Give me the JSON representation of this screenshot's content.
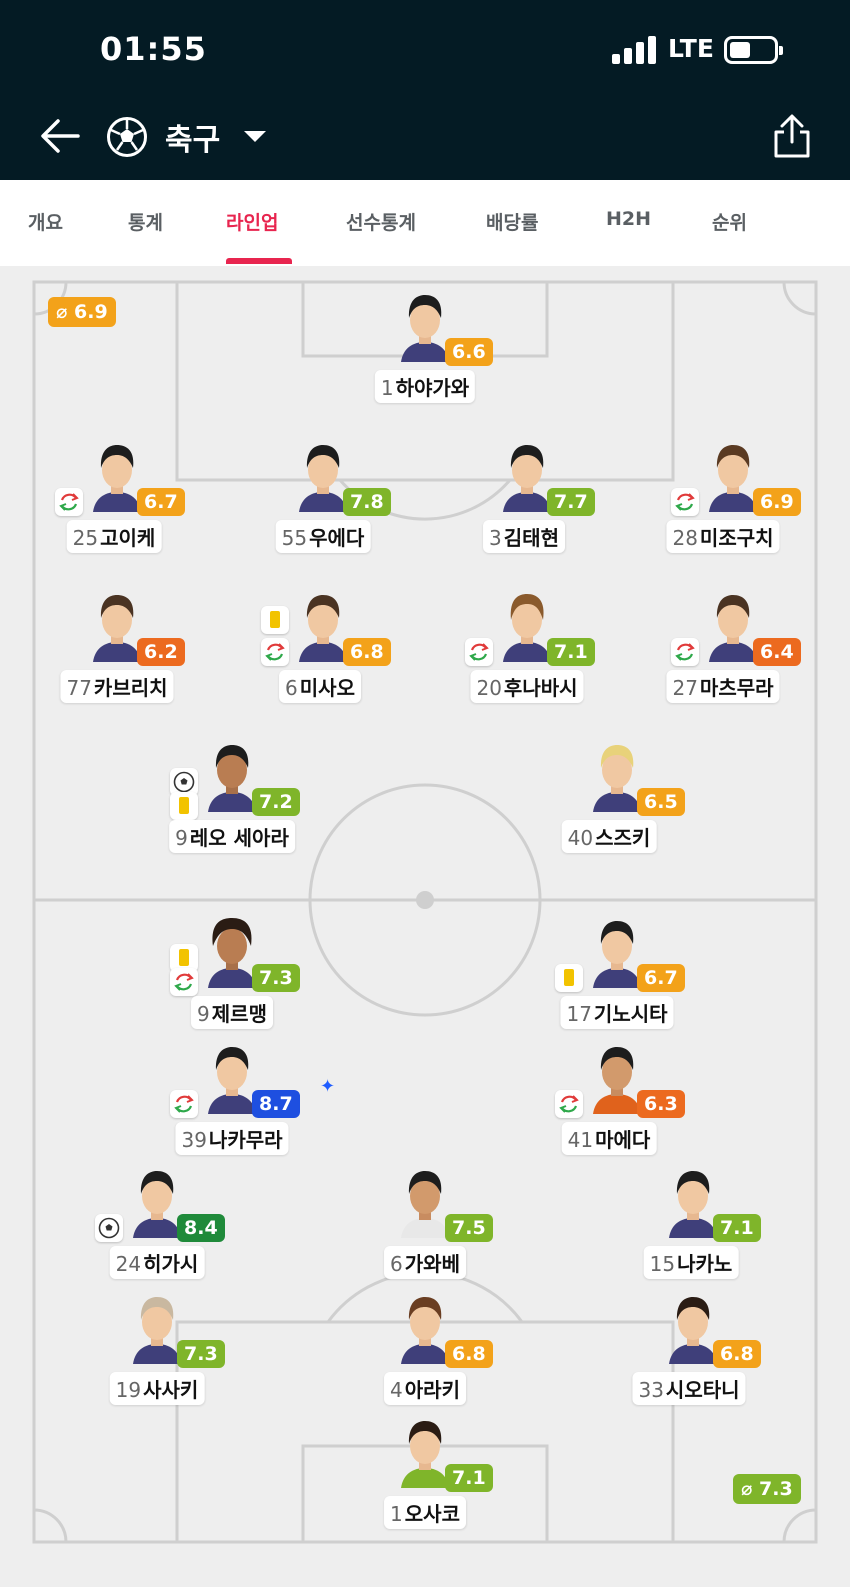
{
  "status_bar": {
    "time": "01:55",
    "network": "LTE"
  },
  "header": {
    "sport": "축구",
    "back_icon": "arrow-left-icon",
    "ball_icon": "soccer-ball-icon",
    "share_icon": "share-icon"
  },
  "tabs": [
    {
      "label": "개요"
    },
    {
      "label": "통계"
    },
    {
      "label": "라인업",
      "active": true
    },
    {
      "label": "선수통계"
    },
    {
      "label": "배당률"
    },
    {
      "label": "H2H"
    },
    {
      "label": "순위"
    }
  ],
  "colors": {
    "orange": "#f3a21a",
    "lightgreen": "#7fb52a",
    "green": "#1f8a3a",
    "darkorange": "#ec6a1f",
    "blue": "#1e4fe0",
    "yellowcard": "#f2c300",
    "accent": "#e8254f"
  },
  "lineup": {
    "home_avg": "⌀ 6.9",
    "away_avg": "⌀ 7.3",
    "home": [
      {
        "num": "1",
        "name": "하야가와",
        "rating": "6.6"
      },
      {
        "num": "25",
        "name": "고이케",
        "rating": "6.7"
      },
      {
        "num": "55",
        "name": "우에다",
        "rating": "7.8"
      },
      {
        "num": "3",
        "name": "김태현",
        "rating": "7.7"
      },
      {
        "num": "28",
        "name": "미조구치",
        "rating": "6.9"
      },
      {
        "num": "77",
        "name": "카브리치",
        "rating": "6.2"
      },
      {
        "num": "6",
        "name": "미사오",
        "rating": "6.8"
      },
      {
        "num": "20",
        "name": "후나바시",
        "rating": "7.1"
      },
      {
        "num": "27",
        "name": "마츠무라",
        "rating": "6.4"
      },
      {
        "num": "9",
        "name": "레오 세아라",
        "rating": "7.2"
      },
      {
        "num": "40",
        "name": "스즈키",
        "rating": "6.5"
      }
    ],
    "away": [
      {
        "num": "9",
        "name": "제르맹",
        "rating": "7.3"
      },
      {
        "num": "17",
        "name": "기노시타",
        "rating": "6.7"
      },
      {
        "num": "39",
        "name": "나카무라",
        "rating": "8.7"
      },
      {
        "num": "41",
        "name": "마에다",
        "rating": "6.3"
      },
      {
        "num": "24",
        "name": "히가시",
        "rating": "8.4"
      },
      {
        "num": "6",
        "name": "가와베",
        "rating": "7.5"
      },
      {
        "num": "15",
        "name": "나카노",
        "rating": "7.1"
      },
      {
        "num": "19",
        "name": "사사키",
        "rating": "7.3"
      },
      {
        "num": "4",
        "name": "아라키",
        "rating": "6.8"
      },
      {
        "num": "33",
        "name": "시오타니",
        "rating": "6.8"
      },
      {
        "num": "1",
        "name": "오사코",
        "rating": "7.1"
      }
    ]
  }
}
